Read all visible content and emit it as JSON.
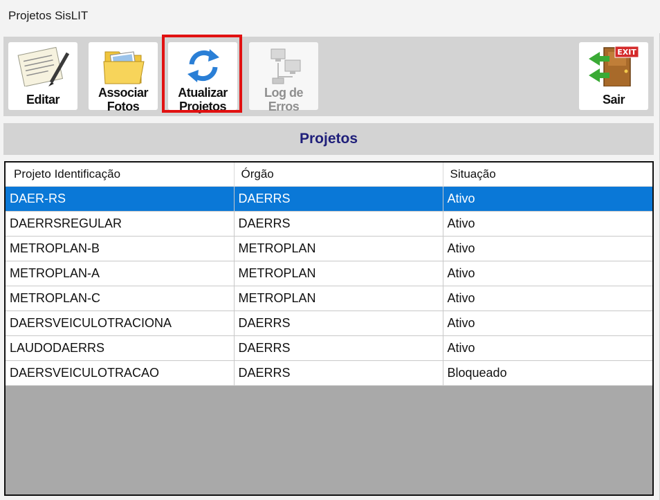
{
  "window": {
    "title": "Projetos SisLIT"
  },
  "toolbar": {
    "buttons": [
      {
        "line1": "Editar",
        "line2": "",
        "icon": "edit-document-icon"
      },
      {
        "line1": "Associar",
        "line2": "Fotos",
        "icon": "photos-folder-icon"
      },
      {
        "line1": "Atualizar",
        "line2": "Projetos",
        "icon": "refresh-arrows-icon"
      },
      {
        "line1": "Log de",
        "line2": "Erros",
        "icon": "network-computers-icon"
      },
      {
        "line1": "Sair",
        "line2": "",
        "icon": "exit-door-icon"
      }
    ]
  },
  "section": {
    "title": "Projetos"
  },
  "grid": {
    "columns": [
      "Projeto Identificação",
      "Órgão",
      "Situação"
    ],
    "rows": [
      {
        "projeto": "DAER-RS",
        "orgao": "DAERRS",
        "situacao": "Ativo"
      },
      {
        "projeto": "DAERRSREGULAR",
        "orgao": "DAERRS",
        "situacao": "Ativo"
      },
      {
        "projeto": "METROPLAN-B",
        "orgao": "METROPLAN",
        "situacao": "Ativo"
      },
      {
        "projeto": "METROPLAN-A",
        "orgao": "METROPLAN",
        "situacao": "Ativo"
      },
      {
        "projeto": "METROPLAN-C",
        "orgao": "METROPLAN",
        "situacao": "Ativo"
      },
      {
        "projeto": "DAERSVEICULOTRACIONA",
        "orgao": "DAERRS",
        "situacao": "Ativo"
      },
      {
        "projeto": "LAUDODAERRS",
        "orgao": "DAERRS",
        "situacao": "Ativo"
      },
      {
        "projeto": "DAERSVEICULOTRACAO",
        "orgao": "DAERRS",
        "situacao": "Bloqueado"
      }
    ]
  },
  "colors": {
    "selected_row": "#0a78d7",
    "highlight_border": "#e11111",
    "header_text": "#1f1f7a"
  }
}
